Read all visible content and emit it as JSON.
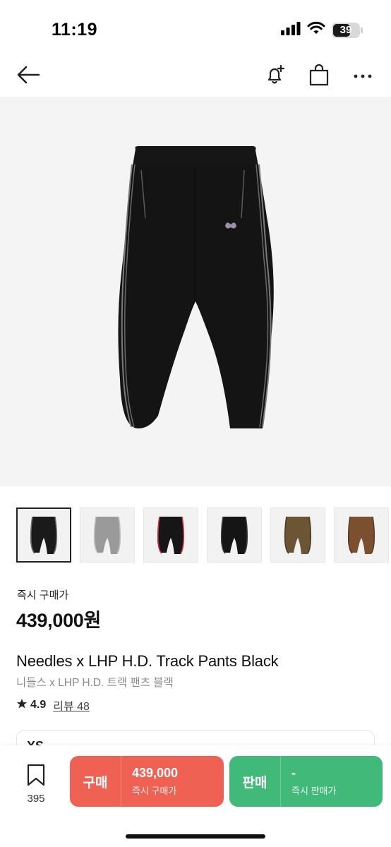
{
  "status": {
    "time": "11:19",
    "battery": "39"
  },
  "icons": {
    "back": "arrow-left-icon",
    "notify": "bell-plus-icon",
    "bag": "shopping-bag-icon",
    "more": "more-icon",
    "bookmark": "bookmark-icon",
    "star": "star-icon"
  },
  "product": {
    "price_label": "즉시 구매가",
    "price": "439,000원",
    "title_en": "Needles x LHP H.D. Track Pants Black",
    "title_ko": "니들스 x LHP H.D. 트랙 팬츠 블랙",
    "rating": "4.9",
    "review_label": "리뷰 48",
    "size_label": "XS"
  },
  "thumbnails": [
    {
      "name": "black",
      "color": "#1a1a1a",
      "stripe": "#6b6b6b"
    },
    {
      "name": "gray",
      "color": "#9a9a9a",
      "stripe": "#bdbdbd"
    },
    {
      "name": "black-red",
      "color": "#161616",
      "stripe": "#c8343a"
    },
    {
      "name": "black-2",
      "color": "#151515",
      "stripe": "#3c3c3c"
    },
    {
      "name": "brown-olive",
      "color": "#6b5535",
      "stripe": "#4a3a22"
    },
    {
      "name": "brown",
      "color": "#7b4f30",
      "stripe": "#5c3a22"
    }
  ],
  "bottom": {
    "bookmark_count": "395",
    "buy_label": "구매",
    "buy_price": "439,000",
    "buy_sub": "즉시 구매가",
    "sell_label": "판매",
    "sell_price": "-",
    "sell_sub": "즉시 판매가"
  },
  "colors": {
    "buy": "#ef6253",
    "sell": "#41b979"
  }
}
